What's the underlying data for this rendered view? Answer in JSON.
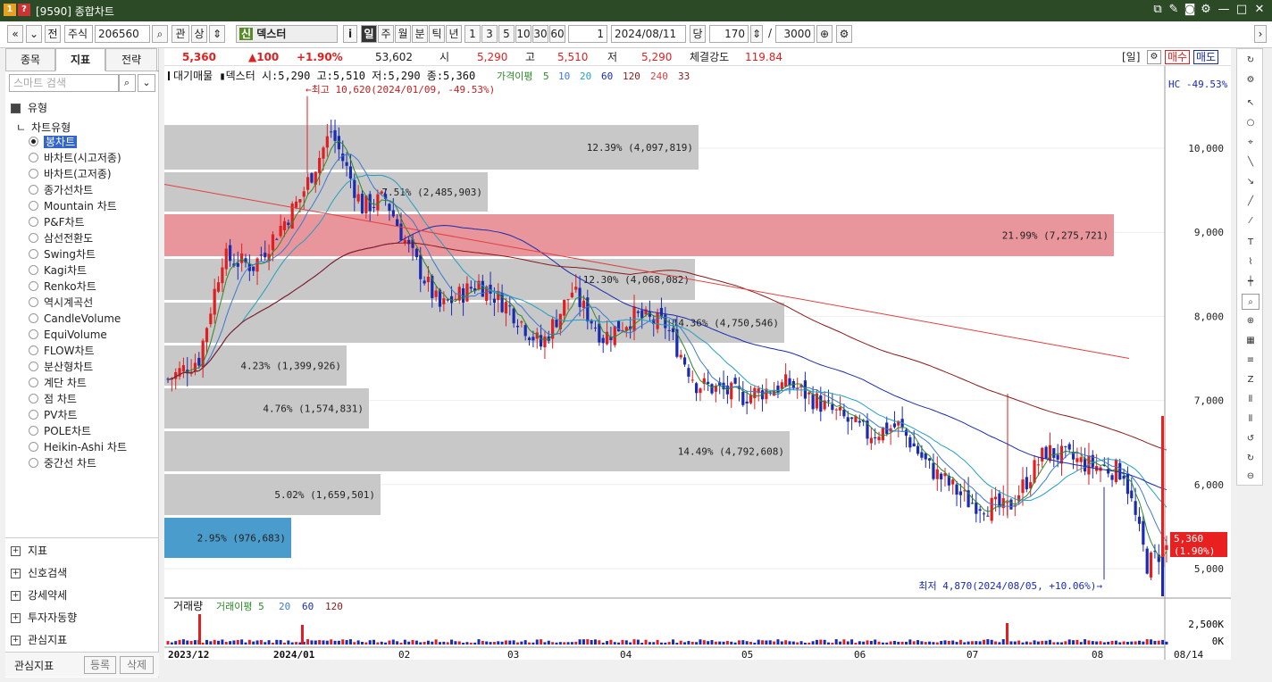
{
  "window": {
    "title": "[9590] 종합차트",
    "icon1": "1",
    "icon2": "?"
  },
  "toolbar": {
    "nav_prev": "«",
    "nav_next": "»",
    "jeon": "전",
    "market": "주식",
    "code": "206560",
    "gwan": "관",
    "sang": "상",
    "sin_badge": "신",
    "stock_name": "덱스터",
    "info": "i",
    "periods": [
      "일",
      "주",
      "월",
      "분",
      "틱",
      "년"
    ],
    "intervals": [
      "1",
      "3",
      "5",
      "10",
      "30",
      "60"
    ],
    "interval_value": "1",
    "date": "2024/08/11",
    "dang": "당",
    "count": "170",
    "slash": "/",
    "total": "3000"
  },
  "left_panel": {
    "tabs": [
      "종목",
      "지표",
      "전략"
    ],
    "search_placeholder": "스마트 검색",
    "section_type": "유형",
    "chart_type_label": "차트유형",
    "chart_types": [
      "봉차트",
      "바차트(시고저종)",
      "바차트(고저종)",
      "종가선차트",
      "Mountain 차트",
      "P&F차트",
      "삼선전환도",
      "Swing차트",
      "Kagi차트",
      "Renko차트",
      "역시계곡선",
      "CandleVolume",
      "EquiVolume",
      "FLOW차트",
      "분산형차트",
      "계단 차트",
      "점 차트",
      "PV차트",
      "POLE차트",
      "Heikin-Ashi 차트",
      "중간선 차트"
    ],
    "selected": "봉차트",
    "bottom_sections": [
      "지표",
      "신호검색",
      "강세약세",
      "투자자동향",
      "관심지표"
    ],
    "footer_label": "관심지표",
    "footer_register": "등록",
    "footer_delete": "삭제"
  },
  "pricebar": {
    "price": "5,360",
    "change": "▲100",
    "change_pct": "+1.90%",
    "volume": "53,602",
    "open_label": "시",
    "open": "5,290",
    "high_label": "고",
    "high": "5,510",
    "low_label": "저",
    "low": "5,290",
    "strength_label": "체결강도",
    "strength": "119.84",
    "period_tag": "[일]",
    "buy": "매수",
    "sell": "매도"
  },
  "chart": {
    "legend": "대기매물 ▮덱스터 시:5,290 고:5,510 저:5,290 종:5,360",
    "ma_label": "가격이평",
    "ma_periods": [
      "5",
      "10",
      "20",
      "60",
      "120",
      "240",
      "33"
    ],
    "hc": "HC -49.53%",
    "high_note": "←최고 10,620(2024/01/09, -49.53%)",
    "low_note": "최저 4,870(2024/08/05, +10.06%)→",
    "current_price": "5,360",
    "current_pct": "(1.90%)",
    "y_ticks": [
      "10,000",
      "9,000",
      "8,000",
      "7,000",
      "6,000",
      "5,000"
    ],
    "x_labels": [
      "2023/12",
      "2024/01",
      "02",
      "03",
      "04",
      "05",
      "06",
      "07",
      "08"
    ],
    "x_end": "08/14",
    "volume_label": "거래량",
    "vol_ma_label": "거래이평",
    "vol_ma": [
      "5",
      "20",
      "60",
      "120"
    ],
    "vol_ticks": [
      "2,500K",
      "0K"
    ],
    "profile": [
      {
        "text": "12.39% (4,097,819)"
      },
      {
        "text": "7.51% (2,485,903)"
      },
      {
        "text": "21.99% (7,275,721)"
      },
      {
        "text": "12.30% (4,068,082)"
      },
      {
        "text": "14.36% (4,750,546)"
      },
      {
        "text": "4.23% (1,399,926)"
      },
      {
        "text": "4.76% (1,574,831)"
      },
      {
        "text": "14.49% (4,792,608)"
      },
      {
        "text": "5.02% (1,659,501)"
      },
      {
        "text": "2.95% (976,683)"
      }
    ],
    "colors": {
      "up": "#e02020",
      "down": "#1a2bb0",
      "highlight": "#e8959c",
      "current": "#4a9ccc",
      "box": "#c8c8c8"
    }
  }
}
